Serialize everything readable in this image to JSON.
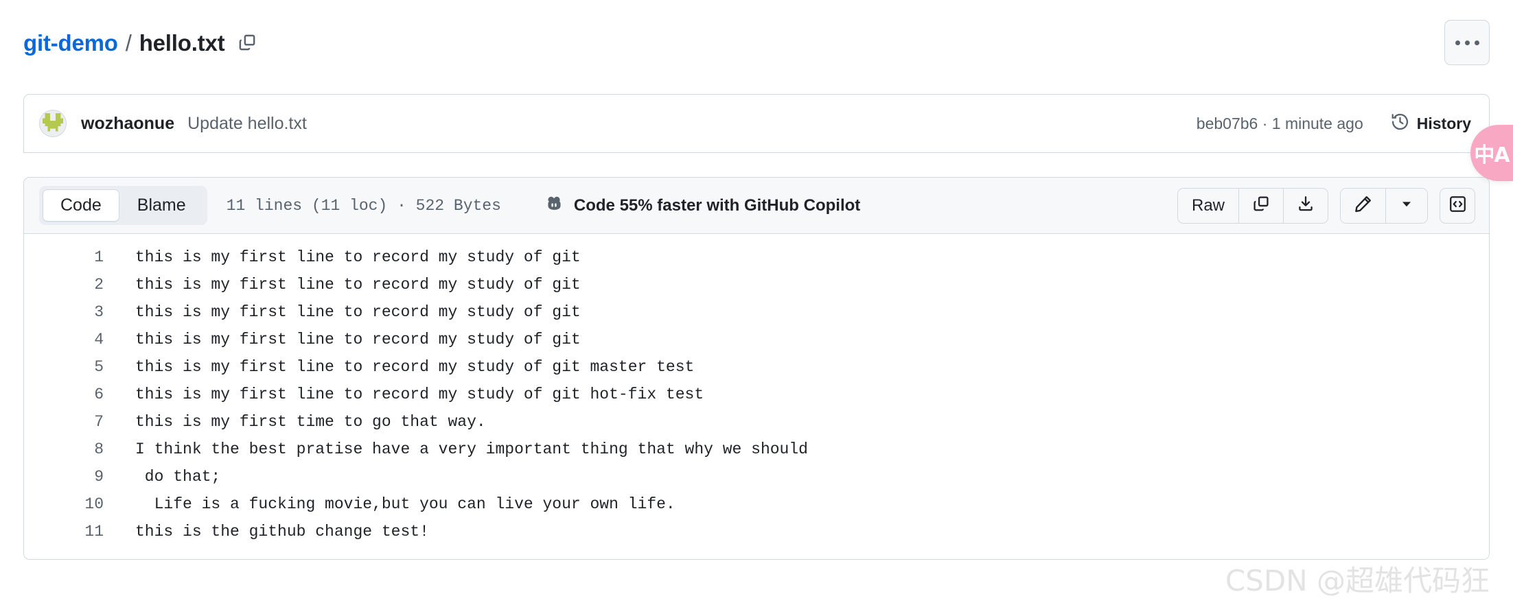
{
  "header": {
    "breadcrumb": {
      "repo": "git-demo",
      "separator": "/",
      "file": "hello.txt",
      "copy_icon": "copy-path-icon"
    },
    "kebab_menu": "more-options-icon"
  },
  "commit": {
    "avatar_alt": "wozhaonue-avatar",
    "author": "wozhaonue",
    "message": "Update hello.txt",
    "meta": "beb07b6 · 1 minute ago",
    "sha": "beb07b6",
    "relative_time": "1 minute ago",
    "history_label": "History",
    "history_icon": "history-clock-icon"
  },
  "file_toolbar": {
    "tabs": [
      {
        "label": "Code",
        "active": true
      },
      {
        "label": "Blame",
        "active": false
      }
    ],
    "stats": "11 lines (11 loc) · 522 Bytes",
    "line_count": "11 lines",
    "loc": "(11 loc)",
    "size": "522 Bytes",
    "copilot_pitch": "Code 55% faster with GitHub Copilot",
    "copilot_icon": "copilot-icon",
    "actions": {
      "raw_label": "Raw",
      "copy_icon": "copy-raw-contents-icon",
      "download_icon": "download-raw-file-icon",
      "edit_icon": "edit-pencil-icon",
      "edit_dropdown_icon": "chevron-down-icon",
      "symbols_icon": "code-symbols-icon"
    }
  },
  "code": {
    "lines": [
      {
        "n": "1",
        "text": "this is my first line to record my study of git"
      },
      {
        "n": "2",
        "text": "this is my first line to record my study of git"
      },
      {
        "n": "3",
        "text": "this is my first line to record my study of git"
      },
      {
        "n": "4",
        "text": "this is my first line to record my study of git"
      },
      {
        "n": "5",
        "text": "this is my first line to record my study of git master test"
      },
      {
        "n": "6",
        "text": "this is my first line to record my study of git hot-fix test"
      },
      {
        "n": "7",
        "text": "this is my first time to go that way."
      },
      {
        "n": "8",
        "text": "I think the best pratise have a very important thing that why we should"
      },
      {
        "n": "9",
        "text": " do that;"
      },
      {
        "n": "10",
        "text": "  Life is a fucking movie,but you can live your own life."
      },
      {
        "n": "11",
        "text": "this is the github change test!"
      }
    ]
  },
  "translate_widget": {
    "glyph": "中A",
    "name": "translate-icon"
  },
  "watermark": {
    "text": "CSDN @超雄代码狂"
  },
  "colors": {
    "link_blue": "#0969da",
    "muted_text": "#59636e",
    "border": "#d1d9e0",
    "toolbar_bg": "#f6f8fa",
    "segmented_bg": "#eaeef2",
    "avatar_green": "#b5c94e",
    "translate_pink": "#f9a8c4"
  }
}
